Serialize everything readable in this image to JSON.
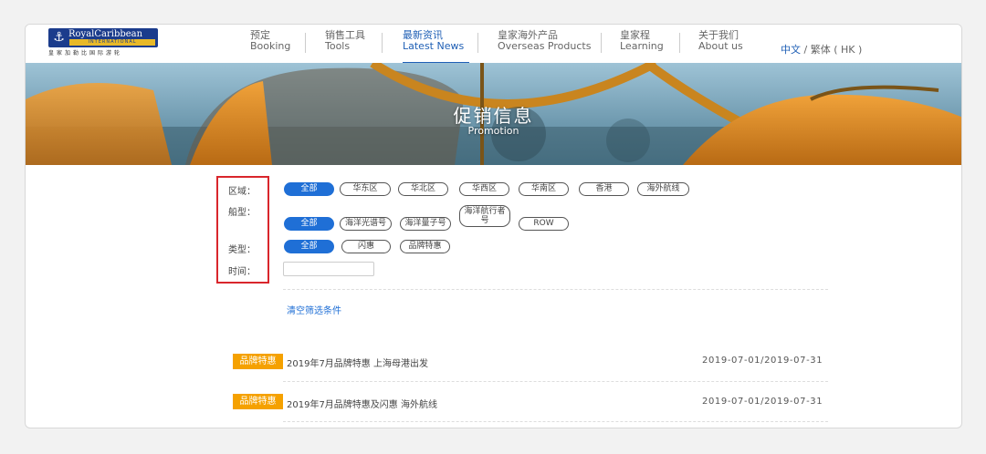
{
  "logo": {
    "brand": "RoyalCaribbean",
    "intl": "INTERNATIONAL",
    "cn": "皇家加勒比国际游轮"
  },
  "nav": [
    {
      "cn": "预定",
      "en": "Booking"
    },
    {
      "cn": "销售工具",
      "en": "Tools"
    },
    {
      "cn": "最新资讯",
      "en": "Latest News"
    },
    {
      "cn": "皇家海外产品",
      "en": "Overseas Products"
    },
    {
      "cn": "皇家程",
      "en": "Learning"
    },
    {
      "cn": "关于我们",
      "en": "About us"
    }
  ],
  "lang": {
    "current": "中文",
    "sep": " / ",
    "other": "繁体 ( HK )"
  },
  "banner": {
    "title": "促销信息",
    "subtitle": "Promotion"
  },
  "filters": {
    "region_label": "区域：",
    "ship_label": "船型：",
    "type_label": "类型：",
    "time_label": "时间：",
    "regions": [
      "全部",
      "华东区",
      "华北区",
      "华西区",
      "华南区",
      "香港",
      "海外航线"
    ],
    "ships": [
      "全部",
      "海洋光谱号",
      "海洋量子号",
      "海洋航行者",
      "号",
      "ROW"
    ],
    "types": [
      "全部",
      "闪惠",
      "品牌特惠"
    ]
  },
  "clear_label": "清空筛选条件",
  "rows": [
    {
      "tag": "品牌特惠",
      "title": "2019年7月品牌特惠 上海母港出发",
      "date": "2019-07-01/2019-07-31"
    },
    {
      "tag": "品牌特惠",
      "title": "2019年7月品牌特惠及闪惠 海外航线",
      "date": "2019-07-01/2019-07-31"
    }
  ],
  "colors": {
    "brand_blue": "#1b3c8c",
    "accent_blue": "#1f6fd6",
    "tag_orange": "#f5a100",
    "highlight_red": "#d9262c"
  }
}
